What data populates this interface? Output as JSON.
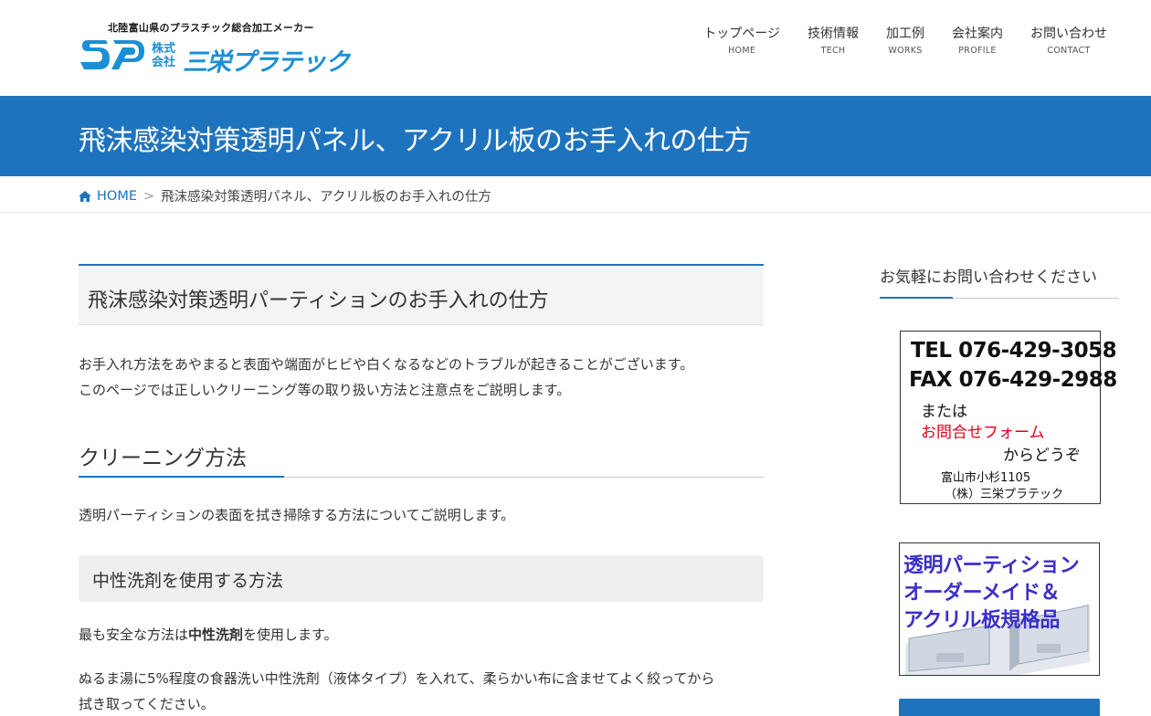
{
  "header": {
    "tagline": "北陸富山県のプラスチック総合加工メーカー",
    "logo_kabu_1": "株式",
    "logo_kabu_2": "会社",
    "logo_name": "三栄プラテック"
  },
  "nav": [
    {
      "jp": "トップページ",
      "en": "HOME"
    },
    {
      "jp": "技術情報",
      "en": "TECH"
    },
    {
      "jp": "加工例",
      "en": "WORKS"
    },
    {
      "jp": "会社案内",
      "en": "PROFILE"
    },
    {
      "jp": "お問い合わせ",
      "en": "CONTACT"
    }
  ],
  "page_title": "飛沫感染対策透明パネル、アクリル板のお手入れの仕方",
  "breadcrumb": {
    "home": "HOME",
    "sep": ">",
    "current": "飛沫感染対策透明パネル、アクリル板のお手入れの仕方"
  },
  "content": {
    "h2": "飛沫感染対策透明パーティションのお手入れの仕方",
    "intro_1": "お手入れ方法をあやまると表面や端面がヒビや白くなるなどのトラブルが起きることがございます。",
    "intro_2": "このページでは正しいクリーニング等の取り扱い方法と注意点をご説明します。",
    "h3": "クリーニング方法",
    "p_clean": "透明パーティションの表面を拭き掃除する方法についてご説明します。",
    "h4": "中性洗剤を使用する方法",
    "p3_pre": "最も安全な方法は",
    "p3_strong": "中性洗剤",
    "p3_post": "を使用します。",
    "p4_1": "ぬるま湯に5%程度の食器洗い中性洗剤（液体タイプ）を入れて、柔らかい布に含ませてよく絞ってから",
    "p4_2": "拭き取ってください。"
  },
  "sidebar": {
    "title": "お気軽にお問い合わせください",
    "tel": "TEL 076-429-3058",
    "fax": "FAX 076-429-2988",
    "or": "または",
    "form": "お問合せフォーム",
    "kara": "からどうぞ",
    "address": "富山市小杉1105",
    "company": "（株）三栄プラテック",
    "banner_1": "透明パーティション",
    "banner_2": "オーダーメイド＆",
    "banner_3": "アクリル板規格品"
  },
  "colors": {
    "primary": "#1e73be",
    "logo_blue": "#1a8fd6",
    "form_red": "#e0001a",
    "banner_purple": "#3a2fc8"
  }
}
